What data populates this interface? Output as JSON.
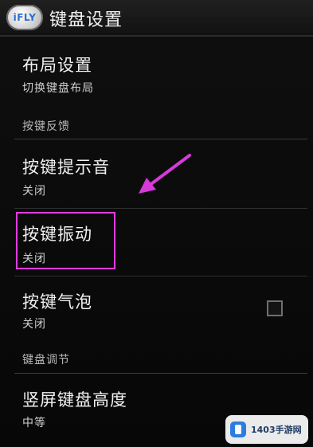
{
  "app": {
    "icon_label": "iFLY",
    "title": "键盘设置"
  },
  "items": {
    "layout": {
      "title": "布局设置",
      "summary": "切换键盘布局"
    },
    "category_feedback": "按键反馈",
    "key_sound": {
      "title": "按键提示音",
      "summary": "关闭"
    },
    "key_vibrate": {
      "title": "按键振动",
      "summary": "关闭"
    },
    "key_bubble": {
      "title": "按键气泡",
      "summary": "关闭",
      "checked": false
    },
    "category_adjust": "键盘调节",
    "portrait_height": {
      "title": "竖屏键盘高度",
      "summary": "中等"
    }
  },
  "annotation": {
    "arrow_color": "#d63ad8",
    "highlight_color": "#e23be0"
  },
  "watermark": {
    "text": "1403手游网"
  }
}
